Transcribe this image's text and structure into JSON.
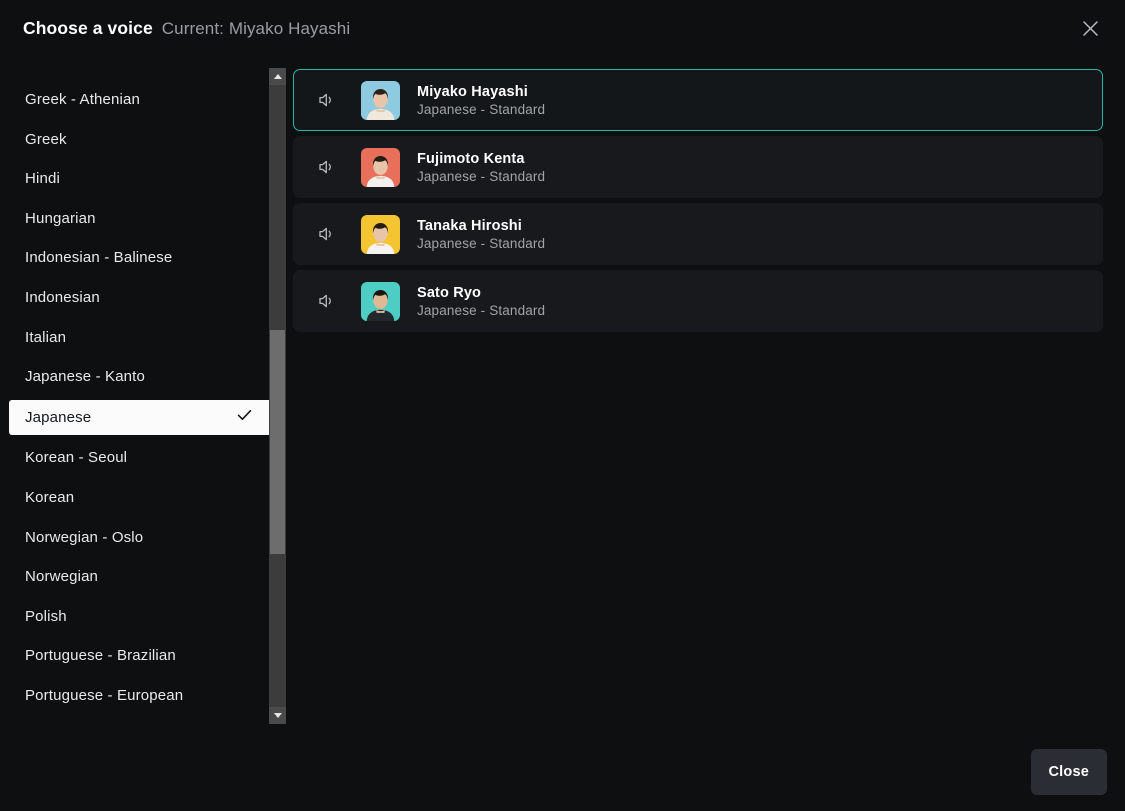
{
  "header": {
    "title": "Choose a voice",
    "current_label": "Current: Miyako Hayashi",
    "close_icon": "close-icon"
  },
  "sidebar": {
    "items": [
      {
        "label": "Greek - Athenian",
        "selected": false
      },
      {
        "label": "Greek",
        "selected": false
      },
      {
        "label": "Hindi",
        "selected": false
      },
      {
        "label": "Hungarian",
        "selected": false
      },
      {
        "label": "Indonesian - Balinese",
        "selected": false
      },
      {
        "label": "Indonesian",
        "selected": false
      },
      {
        "label": "Italian",
        "selected": false
      },
      {
        "label": "Japanese - Kanto",
        "selected": false
      },
      {
        "label": "Japanese",
        "selected": true
      },
      {
        "label": "Korean - Seoul",
        "selected": false
      },
      {
        "label": "Korean",
        "selected": false
      },
      {
        "label": "Norwegian - Oslo",
        "selected": false
      },
      {
        "label": "Norwegian",
        "selected": false
      },
      {
        "label": "Polish",
        "selected": false
      },
      {
        "label": "Portuguese - Brazilian",
        "selected": false
      },
      {
        "label": "Portuguese - European",
        "selected": false
      }
    ],
    "check_icon": "check-icon",
    "scrollbar": {
      "up_icon": "chevron-up-icon",
      "down_icon": "chevron-down-icon"
    }
  },
  "voices": [
    {
      "name": "Miyako Hayashi",
      "meta": "Japanese - Standard",
      "selected": true,
      "avatar_bg": "#8ecbe0",
      "avatar_skin": "#e8c4a8",
      "avatar_hair": "#2b2119",
      "avatar_body": "#f0e7dd",
      "play_icon": "speaker-icon"
    },
    {
      "name": "Fujimoto Kenta",
      "meta": "Japanese - Standard",
      "selected": false,
      "avatar_bg": "#e8705a",
      "avatar_skin": "#e8c4a8",
      "avatar_hair": "#241c15",
      "avatar_body": "#f2f0ee",
      "play_icon": "speaker-icon"
    },
    {
      "name": "Tanaka Hiroshi",
      "meta": "Japanese - Standard",
      "selected": false,
      "avatar_bg": "#f5c431",
      "avatar_skin": "#e8c4a8",
      "avatar_hair": "#241c15",
      "avatar_body": "#f4f3f1",
      "play_icon": "speaker-icon"
    },
    {
      "name": "Sato Ryo",
      "meta": "Japanese - Standard",
      "selected": false,
      "avatar_bg": "#4ecdc4",
      "avatar_skin": "#e0b894",
      "avatar_hair": "#1b1510",
      "avatar_body": "#23272e",
      "play_icon": "speaker-icon"
    }
  ],
  "footer": {
    "close_label": "Close"
  },
  "colors": {
    "background": "#0e0f10",
    "card": "#17191c",
    "accent": "#2cb4a5",
    "selected_pill": "#fbfbfb",
    "button": "#2a2d33"
  }
}
